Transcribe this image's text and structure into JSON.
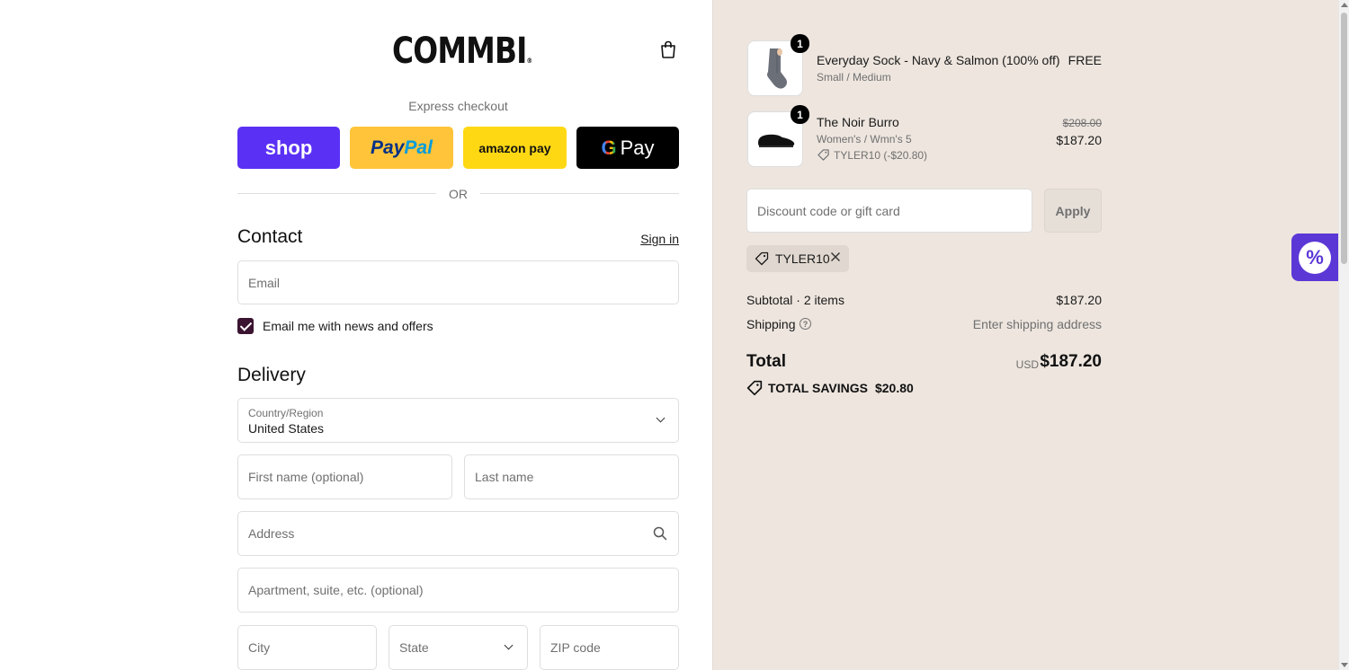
{
  "brand": {
    "logo_text": "COMMBI"
  },
  "express": {
    "label": "Express checkout",
    "buttons": {
      "shop": "shop",
      "paypal_1": "Pay",
      "paypal_2": "Pal",
      "amazon": "amazon pay",
      "google_g": "G",
      "google_pay": "Pay"
    },
    "or_label": "OR"
  },
  "contact": {
    "heading": "Contact",
    "sign_in": "Sign in",
    "email_placeholder": "Email",
    "news_checkbox_label": "Email me with news and offers",
    "news_checked": true
  },
  "delivery": {
    "heading": "Delivery",
    "country_label": "Country/Region",
    "country_value": "United States",
    "first_name_placeholder": "First name (optional)",
    "last_name_placeholder": "Last name",
    "address_placeholder": "Address",
    "apartment_placeholder": "Apartment, suite, etc. (optional)",
    "city_placeholder": "City",
    "state_placeholder": "State",
    "zip_placeholder": "ZIP code"
  },
  "order": {
    "items": [
      {
        "qty": "1",
        "name": "Everyday Sock - Navy & Salmon (100% off)",
        "variant": "Small / Medium",
        "price": "FREE"
      },
      {
        "qty": "1",
        "name": "The Noir Burro",
        "variant": "Women's / Wmn's 5",
        "discount": "TYLER10 (-$20.80)",
        "original_price": "$208.00",
        "price": "$187.20"
      }
    ],
    "discount_placeholder": "Discount code or gift card",
    "apply_label": "Apply",
    "applied_code": "TYLER10",
    "subtotal_label": "Subtotal · 2 items",
    "subtotal_value": "$187.20",
    "shipping_label": "Shipping",
    "shipping_value": "Enter shipping address",
    "total_label": "Total",
    "currency": "USD",
    "total_value": "$187.20",
    "savings_label": "TOTAL SAVINGS",
    "savings_value": "$20.80"
  },
  "colors": {
    "shop_pay": "#5a31f4",
    "paypal": "#ffc439",
    "amazon": "#ffd814",
    "google_pay": "#000000",
    "summary_bg": "#ede5de",
    "checkbox": "#3a1430",
    "promo_widget": "#5b37d6"
  }
}
